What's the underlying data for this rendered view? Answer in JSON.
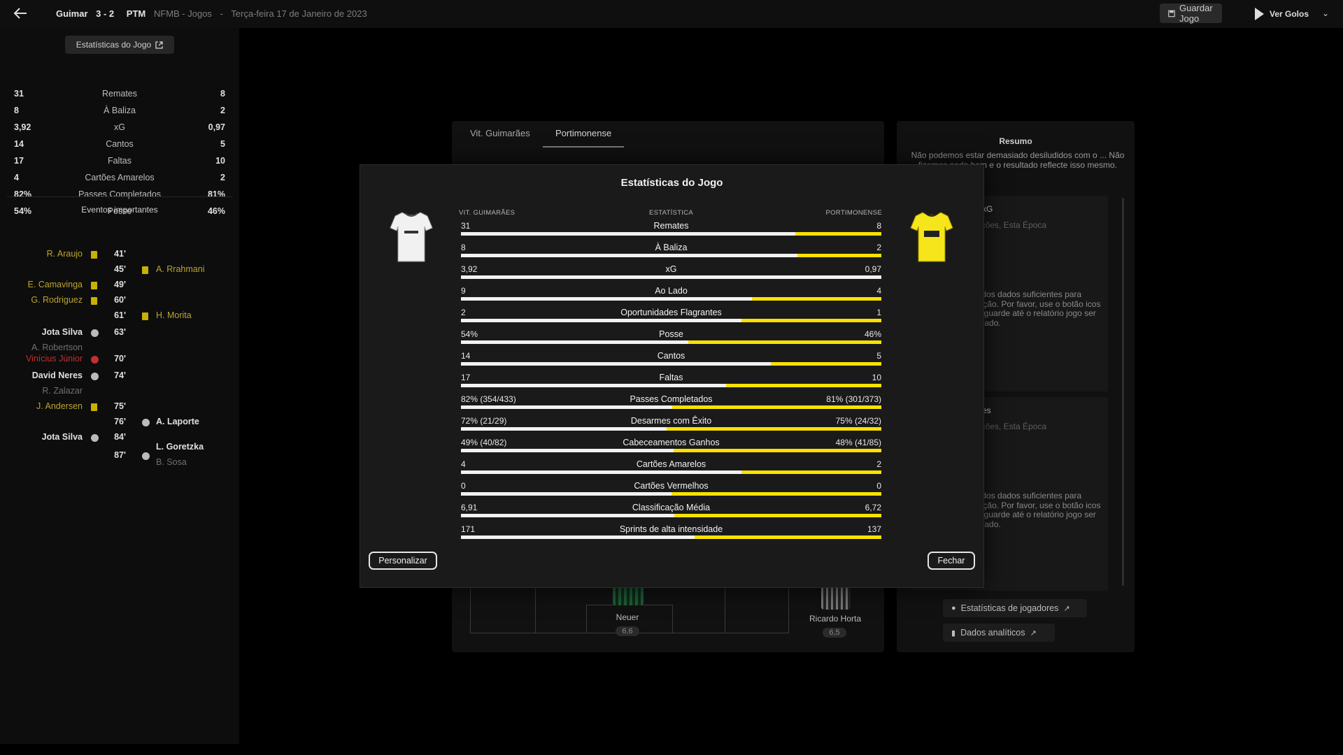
{
  "topbar": {
    "home_short": "Guimar",
    "score": "3 - 2",
    "away_short": "PTM",
    "competition": "NFMB - Jogos",
    "dash": "-",
    "date": "Terça-feira 17 de Janeiro de 2023",
    "save_label": "Guardar Jogo",
    "goals_label": "Ver Golos"
  },
  "left": {
    "stats_button": "Estatísticas do Jogo",
    "stats": [
      {
        "home": "31",
        "label": "Remates",
        "away": "8"
      },
      {
        "home": "8",
        "label": "À Baliza",
        "away": "2"
      },
      {
        "home": "3,92",
        "label": "xG",
        "away": "0,97"
      },
      {
        "home": "14",
        "label": "Cantos",
        "away": "5"
      },
      {
        "home": "17",
        "label": "Faltas",
        "away": "10"
      },
      {
        "home": "4",
        "label": "Cartões Amarelos",
        "away": "2"
      },
      {
        "home": "82%",
        "label": "Passes Completados",
        "away": "81%"
      },
      {
        "home": "54%",
        "label": "Posse",
        "away": "46%"
      }
    ],
    "events_title": "Eventos importantes",
    "events": [
      {
        "minute": "41'",
        "home": "R. Araujo",
        "home_sub": "",
        "away": "",
        "away_sub": "",
        "icon": "yellow-card"
      },
      {
        "minute": "45'",
        "home": "",
        "home_sub": "",
        "away": "A. Rrahmani",
        "away_sub": "",
        "icon": "yellow-card"
      },
      {
        "minute": "49'",
        "home": "E. Camavinga",
        "home_sub": "",
        "away": "",
        "away_sub": "",
        "icon": "yellow-card"
      },
      {
        "minute": "60'",
        "home": "G. Rodriguez",
        "home_sub": "",
        "away": "",
        "away_sub": "",
        "icon": "yellow-card"
      },
      {
        "minute": "61'",
        "home": "",
        "home_sub": "",
        "away": "H. Morita",
        "away_sub": "",
        "icon": "yellow-card"
      },
      {
        "minute": "63'",
        "home": "Jota Silva",
        "home_sub": "A. Robertson",
        "away": "",
        "away_sub": "",
        "icon": "goal"
      },
      {
        "minute": "70'",
        "home": "Vinícius Júnior",
        "home_sub": "",
        "away": "",
        "away_sub": "",
        "icon": "own-goal"
      },
      {
        "minute": "74'",
        "home": "David Neres",
        "home_sub": "R. Zalazar",
        "away": "",
        "away_sub": "",
        "icon": "goal"
      },
      {
        "minute": "75'",
        "home": "J. Andersen",
        "home_sub": "",
        "away": "",
        "away_sub": "",
        "icon": "yellow-card"
      },
      {
        "minute": "76'",
        "home": "",
        "home_sub": "",
        "away": "A. Laporte",
        "away_sub": "",
        "icon": "goal"
      },
      {
        "minute": "84'",
        "home": "Jota Silva",
        "home_sub": "",
        "away": "",
        "away_sub": "",
        "icon": "goal"
      },
      {
        "minute": "87'",
        "home": "",
        "home_sub": "",
        "away": "L. Goretzka",
        "away_sub": "B. Sosa",
        "icon": "goal"
      }
    ]
  },
  "background": {
    "tabs": [
      "Vit. Guimarães",
      "Portimonense"
    ],
    "player_left": {
      "name": "Neuer",
      "rating": "6,6"
    },
    "player_right": {
      "name": "Ricardo Horta",
      "rating": "6,5"
    },
    "summary_title": "Resumo",
    "summary_text": "Não podemos estar demasiado desiludidos com o ... Não fizemos nada bem e o resultado reflecte isso mesmo.",
    "card1_title": "xG",
    "card1_sub": "ições, Esta Época",
    "card1_text": "gados dados suficientes para ização. Por favor, use o botão icos e aguarde até o relatório jogo ser gerado.",
    "card2_title": "es",
    "card2_sub": "ições, Esta Época",
    "card2_text": "gados dados suficientes para ização. Por favor, use o botão icos e aguarde até o relatório jogo ser gerado.",
    "btn_players": "Estatísticas de jogadores",
    "btn_analytics": "Dados analíticos"
  },
  "modal": {
    "title": "Estatísticas do Jogo",
    "col_home": "VIT. GUIMARÃES",
    "col_stat": "ESTATÍSTICA",
    "col_away": "PORTIMONENSE",
    "home_color": "#f2f2f2",
    "away_color": "#ffe100",
    "rows": [
      {
        "home": "31",
        "label": "Remates",
        "away": "8",
        "home_share": 0.795
      },
      {
        "home": "8",
        "label": "À Baliza",
        "away": "2",
        "home_share": 0.8
      },
      {
        "home": "3,92",
        "label": "xG",
        "away": "0,97",
        "home_share": 1.0
      },
      {
        "home": "9",
        "label": "Ao Lado",
        "away": "4",
        "home_share": 0.692
      },
      {
        "home": "2",
        "label": "Oportunidades Flagrantes",
        "away": "1",
        "home_share": 0.667
      },
      {
        "home": "54%",
        "label": "Posse",
        "away": "46%",
        "home_share": 0.54
      },
      {
        "home": "14",
        "label": "Cantos",
        "away": "5",
        "home_share": 0.737
      },
      {
        "home": "17",
        "label": "Faltas",
        "away": "10",
        "home_share": 0.63
      },
      {
        "home": "82% (354/433)",
        "label": "Passes Completados",
        "away": "81% (301/373)",
        "home_share": 0.503
      },
      {
        "home": "72% (21/29)",
        "label": "Desarmes com Êxito",
        "away": "75% (24/32)",
        "home_share": 0.49
      },
      {
        "home": "49% (40/82)",
        "label": "Cabeceamentos Ganhos",
        "away": "48% (41/85)",
        "home_share": 0.505
      },
      {
        "home": "4",
        "label": "Cartões Amarelos",
        "away": "2",
        "home_share": 0.667
      },
      {
        "home": "0",
        "label": "Cartões Vermelhos",
        "away": "0",
        "home_share": 0.5
      },
      {
        "home": "6,91",
        "label": "Classificação Média",
        "away": "6,72",
        "home_share": 0.507
      },
      {
        "home": "171",
        "label": "Sprints de alta intensidade",
        "away": "137",
        "home_share": 0.555
      }
    ],
    "customize_label": "Personalizar",
    "close_label": "Fechar"
  }
}
